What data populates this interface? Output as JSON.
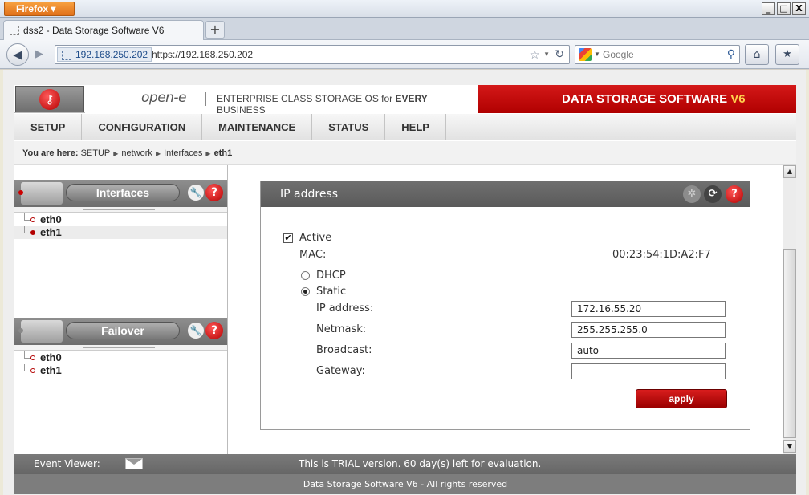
{
  "browser": {
    "menu_button": "Firefox",
    "tab_title": "dss2 - Data Storage Software V6",
    "new_tab": "+",
    "identity": "192.168.250.202",
    "url": "https://192.168.250.202",
    "search_placeholder": "Google",
    "window_buttons": [
      "_",
      "□",
      "X"
    ]
  },
  "app": {
    "logo": "open-e",
    "tagline_pre": "ENTERPRISE CLASS STORAGE OS for ",
    "tagline_bold": "EVERY",
    "tagline_post": " BUSINESS",
    "brand": "DATA STORAGE SOFTWARE",
    "brand_version": "V6",
    "menu": [
      "SETUP",
      "CONFIGURATION",
      "MAINTENANCE",
      "STATUS",
      "HELP"
    ],
    "breadcrumb": {
      "label": "You are here:",
      "items": [
        "SETUP",
        "network",
        "Interfaces"
      ],
      "current": "eth1"
    }
  },
  "left_panel": {
    "interfaces": {
      "title": "Interfaces",
      "items": [
        "eth0",
        "eth1"
      ],
      "selected": "eth1"
    },
    "failover": {
      "title": "Failover",
      "items": [
        "eth0",
        "eth1"
      ]
    }
  },
  "ip_panel": {
    "title": "IP address",
    "active_label": "Active",
    "active_checked": true,
    "mac_label": "MAC:",
    "mac_value": "00:23:54:1D:A2:F7",
    "dhcp_label": "DHCP",
    "static_label": "Static",
    "mode": "static",
    "ip_label": "IP address:",
    "ip_value": "172.16.55.20",
    "netmask_label": "Netmask:",
    "netmask_value": "255.255.255.0",
    "broadcast_label": "Broadcast:",
    "broadcast_value": "auto",
    "gateway_label": "Gateway:",
    "gateway_value": "",
    "apply_label": "apply"
  },
  "footer": {
    "event_viewer": "Event Viewer:",
    "trial_notice": "This is TRIAL version. 60 day(s) left for evaluation.",
    "copyright": "Data Storage Software V6 - All rights reserved"
  },
  "colors": {
    "brand_red": "#c00000",
    "header_gray": "#6a6a6a",
    "accent_yellow": "#ffd24d"
  }
}
